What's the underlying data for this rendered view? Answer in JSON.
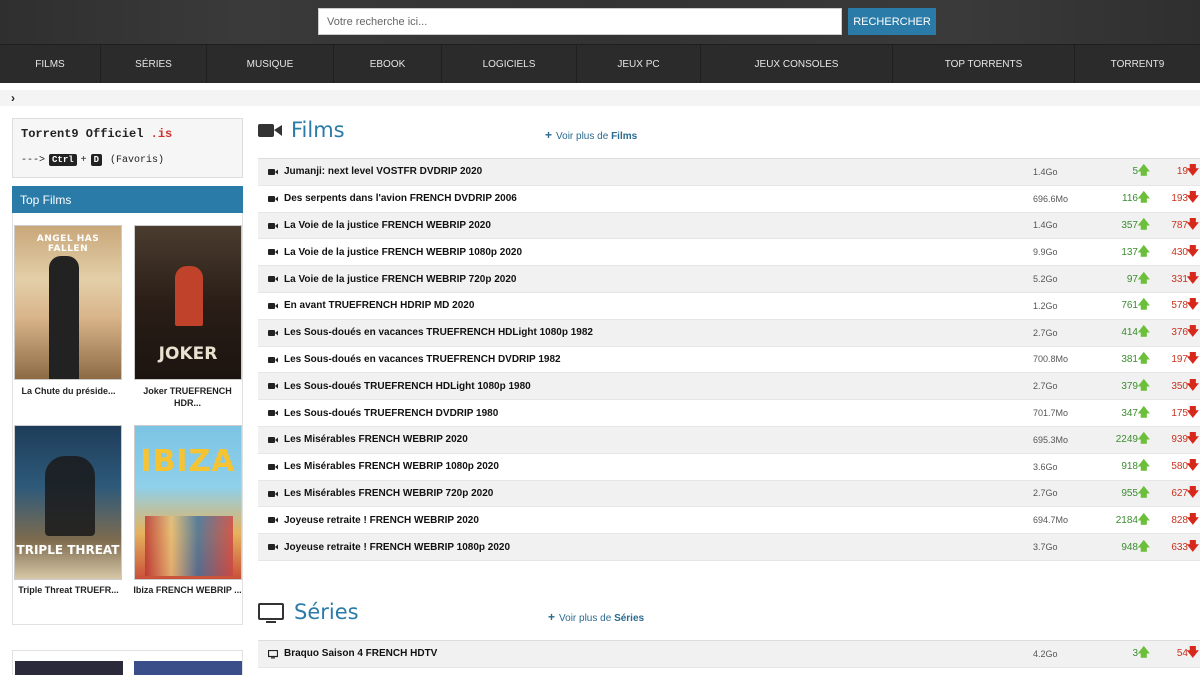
{
  "search": {
    "placeholder": "Votre recherche ici...",
    "button_label": "RECHERCHER"
  },
  "nav": [
    "FILMS",
    "SÉRIES",
    "MUSIQUE",
    "EBOOK",
    "LOGICIELS",
    "JEUX PC",
    "JEUX CONSOLES",
    "TOP TORRENTS",
    "TORRENT9"
  ],
  "breadcrumb_icon": "chevron-right-icon",
  "brand": {
    "title": "Torrent9 Officiel",
    "tld": ".is",
    "arrow": "--->",
    "key1": "Ctrl",
    "plus": "+",
    "key2": "D",
    "favoris": "(Favoris)"
  },
  "sidebar": {
    "top_films_title": "Top Films",
    "posters": [
      {
        "caption": "La Chute du préside...",
        "art_text": "ANGEL HAS FALLEN"
      },
      {
        "caption": "Joker TRUEFRENCH HDR...",
        "art_text": "JOKER"
      },
      {
        "caption": "Triple Threat TRUEFR...",
        "art_text": "TRIPLE THREAT"
      },
      {
        "caption": "Ibiza FRENCH WEBRIP ...",
        "art_text": "IBIZA"
      }
    ]
  },
  "films": {
    "title": "Films",
    "voir_plus_prefix": "Voir plus de",
    "voir_plus_target": "Films",
    "rows": [
      {
        "name": "Jumanji: next level VOSTFR DVDRIP 2020",
        "size": "1.4Go",
        "seeders": "5",
        "leechers": "19"
      },
      {
        "name": "Des serpents dans l'avion FRENCH DVDRIP 2006",
        "size": "696.6Mo",
        "seeders": "116",
        "leechers": "193"
      },
      {
        "name": "La Voie de la justice FRENCH WEBRIP 2020",
        "size": "1.4Go",
        "seeders": "357",
        "leechers": "787"
      },
      {
        "name": "La Voie de la justice FRENCH WEBRIP 1080p 2020",
        "size": "9.9Go",
        "seeders": "137",
        "leechers": "430"
      },
      {
        "name": "La Voie de la justice FRENCH WEBRIP 720p 2020",
        "size": "5.2Go",
        "seeders": "97",
        "leechers": "331"
      },
      {
        "name": "En avant TRUEFRENCH HDRIP MD 2020",
        "size": "1.2Go",
        "seeders": "761",
        "leechers": "578"
      },
      {
        "name": "Les Sous-doués en vacances TRUEFRENCH HDLight 1080p 1982",
        "size": "2.7Go",
        "seeders": "414",
        "leechers": "376"
      },
      {
        "name": "Les Sous-doués en vacances TRUEFRENCH DVDRIP 1982",
        "size": "700.8Mo",
        "seeders": "381",
        "leechers": "197"
      },
      {
        "name": "Les Sous-doués TRUEFRENCH HDLight 1080p 1980",
        "size": "2.7Go",
        "seeders": "379",
        "leechers": "350"
      },
      {
        "name": "Les Sous-doués TRUEFRENCH DVDRIP 1980",
        "size": "701.7Mo",
        "seeders": "347",
        "leechers": "175"
      },
      {
        "name": "Les Misérables FRENCH WEBRIP 2020",
        "size": "695.3Mo",
        "seeders": "2249",
        "leechers": "939"
      },
      {
        "name": "Les Misérables FRENCH WEBRIP 1080p 2020",
        "size": "3.6Go",
        "seeders": "918",
        "leechers": "580"
      },
      {
        "name": "Les Misérables FRENCH WEBRIP 720p 2020",
        "size": "2.7Go",
        "seeders": "955",
        "leechers": "627"
      },
      {
        "name": "Joyeuse retraite ! FRENCH WEBRIP 2020",
        "size": "694.7Mo",
        "seeders": "2184",
        "leechers": "828"
      },
      {
        "name": "Joyeuse retraite ! FRENCH WEBRIP 1080p 2020",
        "size": "3.7Go",
        "seeders": "948",
        "leechers": "633"
      }
    ]
  },
  "series": {
    "title": "Séries",
    "voir_plus_prefix": "Voir plus de",
    "voir_plus_target": "Séries",
    "rows": [
      {
        "name": "Braquo Saison 4 FRENCH HDTV",
        "size": "4.2Go",
        "seeders": "3",
        "leechers": "54"
      }
    ]
  },
  "colors": {
    "accent": "#2a7ba8",
    "header_bg": "#333333",
    "nav_bg": "#2b2b2b",
    "seed_green": "#3a8c2f",
    "leech_red": "#c8321e"
  }
}
